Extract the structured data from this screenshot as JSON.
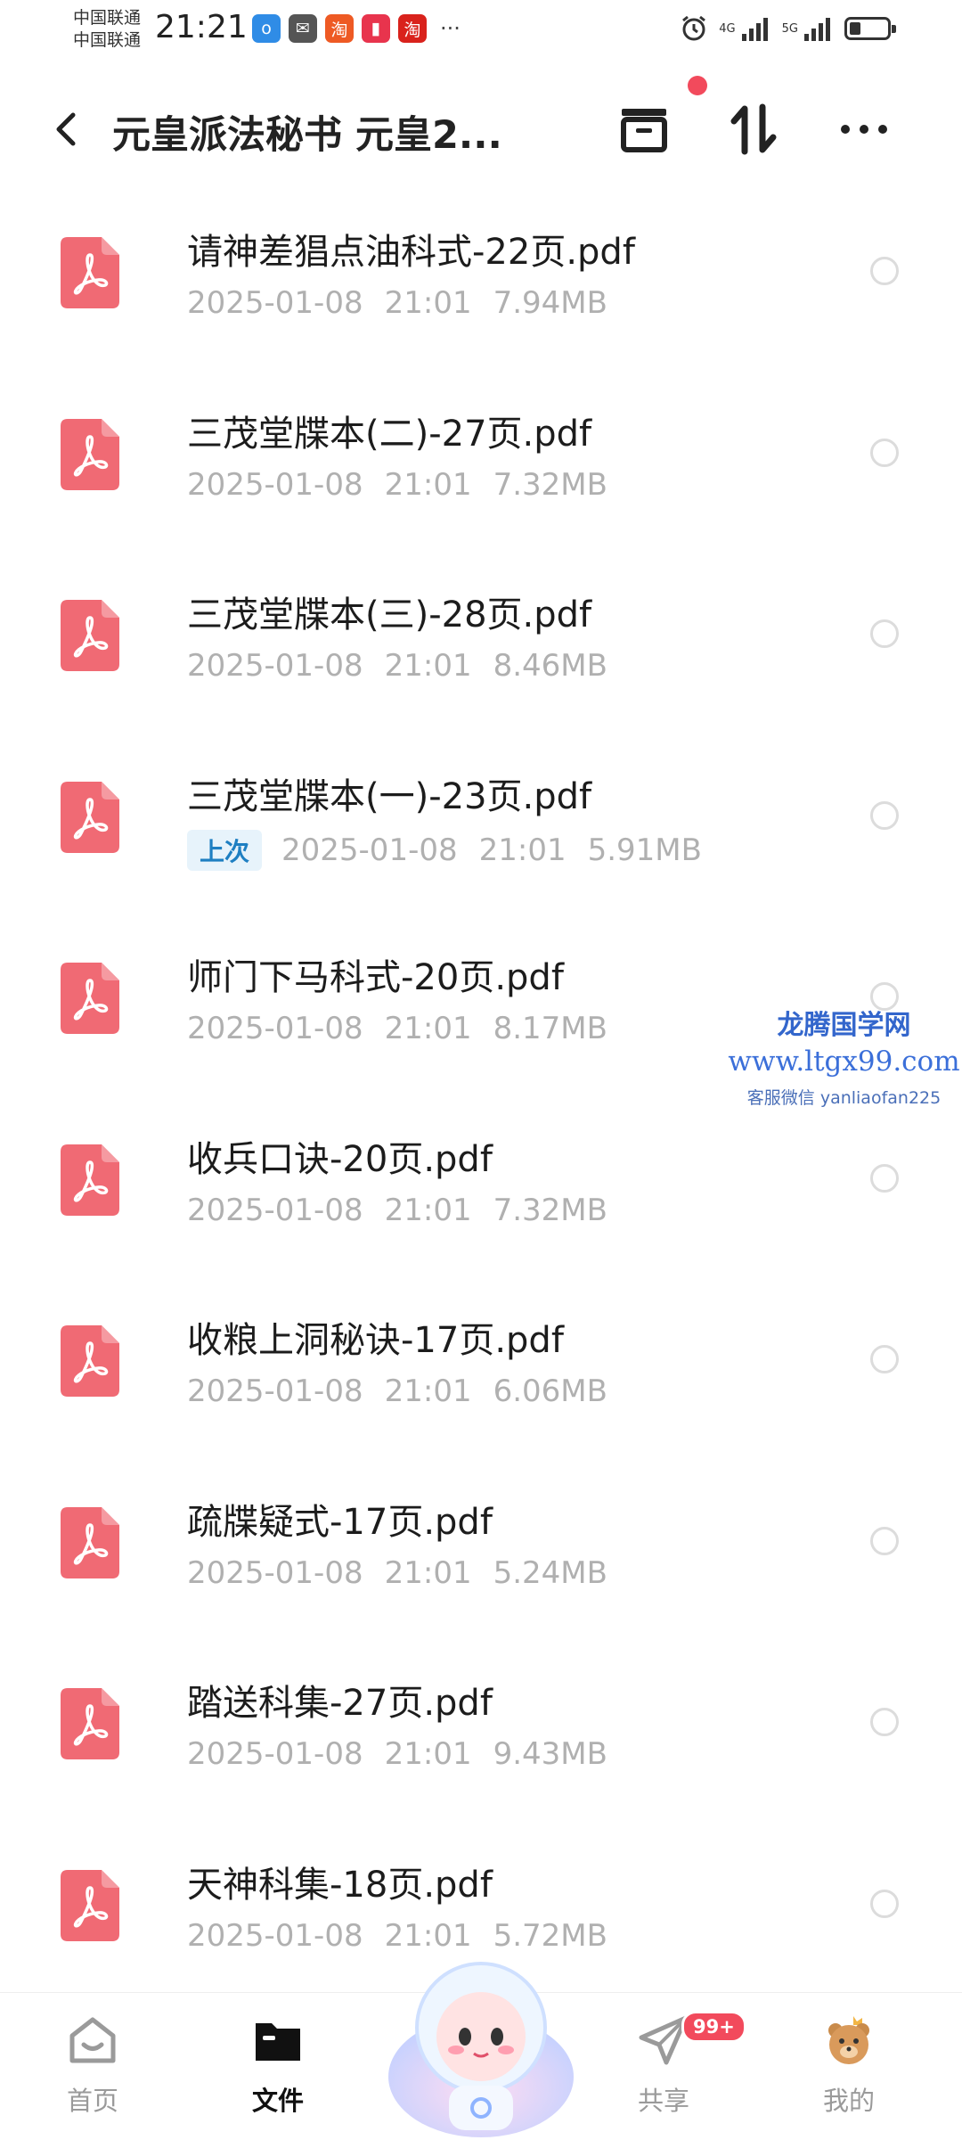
{
  "status_bar": {
    "carrier_1": "中国联通",
    "carrier_2": "中国联通",
    "time": "21:21",
    "app_icons": [
      {
        "name": "blue-app-icon",
        "glyph": "o",
        "color": "#2f8ce6"
      },
      {
        "name": "wechat-icon",
        "glyph": "✉",
        "color": "#555555"
      },
      {
        "name": "taobao-icon",
        "glyph": "淘",
        "color": "#ee5a24"
      },
      {
        "name": "red-book-icon",
        "glyph": "▮",
        "color": "#e8344d"
      },
      {
        "name": "taobao-sale-icon",
        "glyph": "淘",
        "color": "#d9221c"
      }
    ],
    "more_notifications": "···",
    "network_1": "4G",
    "network_2": "5G",
    "battery_level": 0.3
  },
  "header": {
    "title": "元皇派法秘书 元皇2...",
    "has_unread_dot": true
  },
  "files": [
    {
      "name": "请神差猖点油科式-22页.pdf",
      "date": "2025-01-08",
      "time": "21:01",
      "size": "7.94MB",
      "tag": ""
    },
    {
      "name": "三茂堂牒本(二)-27页.pdf",
      "date": "2025-01-08",
      "time": "21:01",
      "size": "7.32MB",
      "tag": ""
    },
    {
      "name": "三茂堂牒本(三)-28页.pdf",
      "date": "2025-01-08",
      "time": "21:01",
      "size": "8.46MB",
      "tag": ""
    },
    {
      "name": "三茂堂牒本(一)-23页.pdf",
      "date": "2025-01-08",
      "time": "21:01",
      "size": "5.91MB",
      "tag": "上次"
    },
    {
      "name": "师门下马科式-20页.pdf",
      "date": "2025-01-08",
      "time": "21:01",
      "size": "8.17MB",
      "tag": ""
    },
    {
      "name": "收兵口诀-20页.pdf",
      "date": "2025-01-08",
      "time": "21:01",
      "size": "7.32MB",
      "tag": ""
    },
    {
      "name": "收粮上洞秘诀-17页.pdf",
      "date": "2025-01-08",
      "time": "21:01",
      "size": "6.06MB",
      "tag": ""
    },
    {
      "name": "疏牒疑式-17页.pdf",
      "date": "2025-01-08",
      "time": "21:01",
      "size": "5.24MB",
      "tag": ""
    },
    {
      "name": "踏送科集-27页.pdf",
      "date": "2025-01-08",
      "time": "21:01",
      "size": "9.43MB",
      "tag": ""
    },
    {
      "name": "天神科集-18页.pdf",
      "date": "2025-01-08",
      "time": "21:01",
      "size": "5.72MB",
      "tag": ""
    }
  ],
  "watermark": {
    "line1": "龙腾国学网",
    "line2": "www.ltgx99.com",
    "line3": "客服微信 yanliaofan225"
  },
  "bottom_nav": {
    "home": "首页",
    "files": "文件",
    "share": "共享",
    "share_badge": "99+",
    "mine": "我的"
  },
  "colors": {
    "accent_red": "#f24a5c",
    "pdf_icon": "#f06a74",
    "last_tag_bg": "#e7f3fb",
    "last_tag_text": "#1e7fc2"
  }
}
